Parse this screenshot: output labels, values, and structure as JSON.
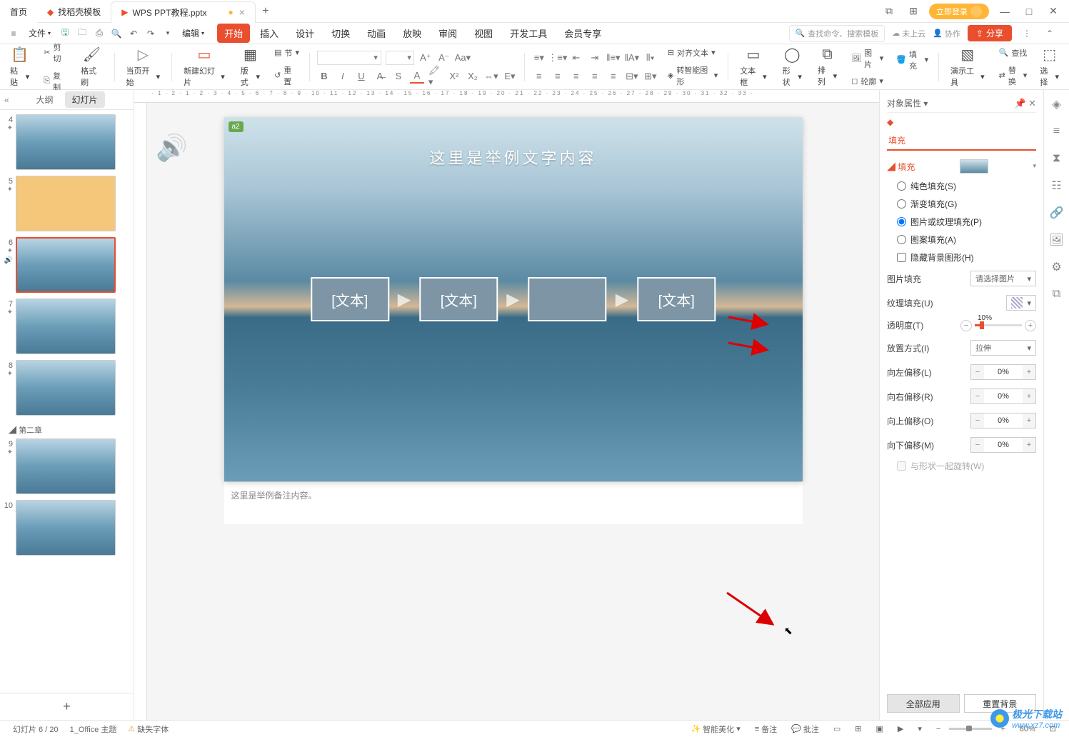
{
  "titlebar": {
    "home_tab": "首页",
    "template_tab": "找稻壳模板",
    "doc_tab": "WPS PPT教程.pptx",
    "login": "立即登录"
  },
  "menubar": {
    "file": "文件",
    "edit": "编辑",
    "tabs": [
      "开始",
      "插入",
      "设计",
      "切换",
      "动画",
      "放映",
      "审阅",
      "视图",
      "开发工具",
      "会员专享"
    ],
    "active_tab_index": 0,
    "search_placeholder": "查找命令、搜索模板",
    "cloud": "未上云",
    "collab": "协作",
    "share": "分享"
  },
  "ribbon": {
    "paste": "粘贴",
    "cut": "剪切",
    "copy": "复制",
    "format_painter": "格式刷",
    "start_from": "当页开始",
    "new_slide": "新建幻灯片",
    "layout": "版式",
    "section": "节",
    "reset": "重置",
    "align_text": "对齐文本",
    "smart_convert": "转智能图形",
    "textbox": "文本框",
    "shape": "形状",
    "arrange": "排列",
    "picture": "图片",
    "fill": "填充",
    "outline": "轮廓",
    "demo_tool": "演示工具",
    "find": "查找",
    "replace": "替换",
    "select": "选择"
  },
  "slidepanel": {
    "outline_tab": "大纲",
    "slides_tab": "幻灯片",
    "section2": "第二章",
    "visible_nums": [
      4,
      5,
      6,
      7,
      8,
      9,
      10
    ],
    "selected": 6
  },
  "canvas": {
    "title_text": "这里是举例文字内容",
    "box_text": "[文本]",
    "tag": "a2",
    "notes": "这里是举例备注内容。"
  },
  "props": {
    "panel_title": "对象属性",
    "fill_tab": "填充",
    "fill_section": "填充",
    "solid": "纯色填充(S)",
    "gradient": "渐变填充(G)",
    "picture": "图片或纹理填充(P)",
    "pattern": "图案填充(A)",
    "hide_bg": "隐藏背景图形(H)",
    "pic_fill": "图片填充",
    "pic_select": "请选择图片",
    "texture_fill": "纹理填充(U)",
    "opacity": "透明度(T)",
    "opacity_val": "10%",
    "tile_mode": "放置方式(I)",
    "tile_val": "拉伸",
    "off_left": "向左偏移(L)",
    "off_right": "向右偏移(R)",
    "off_top": "向上偏移(O)",
    "off_bottom": "向下偏移(M)",
    "offset_val": "0%",
    "rotate_with": "与形状一起旋转(W)",
    "apply_all": "全部应用",
    "reset_bg": "重置背景"
  },
  "statusbar": {
    "slide_pos": "幻灯片 6 / 20",
    "theme": "1_Office 主题",
    "missing_font": "缺失字体",
    "beautify": "智能美化",
    "notes": "备注",
    "comments": "批注",
    "zoom": "80%"
  },
  "watermark": {
    "name": "极光下载站",
    "url": "www.xz7.com"
  }
}
